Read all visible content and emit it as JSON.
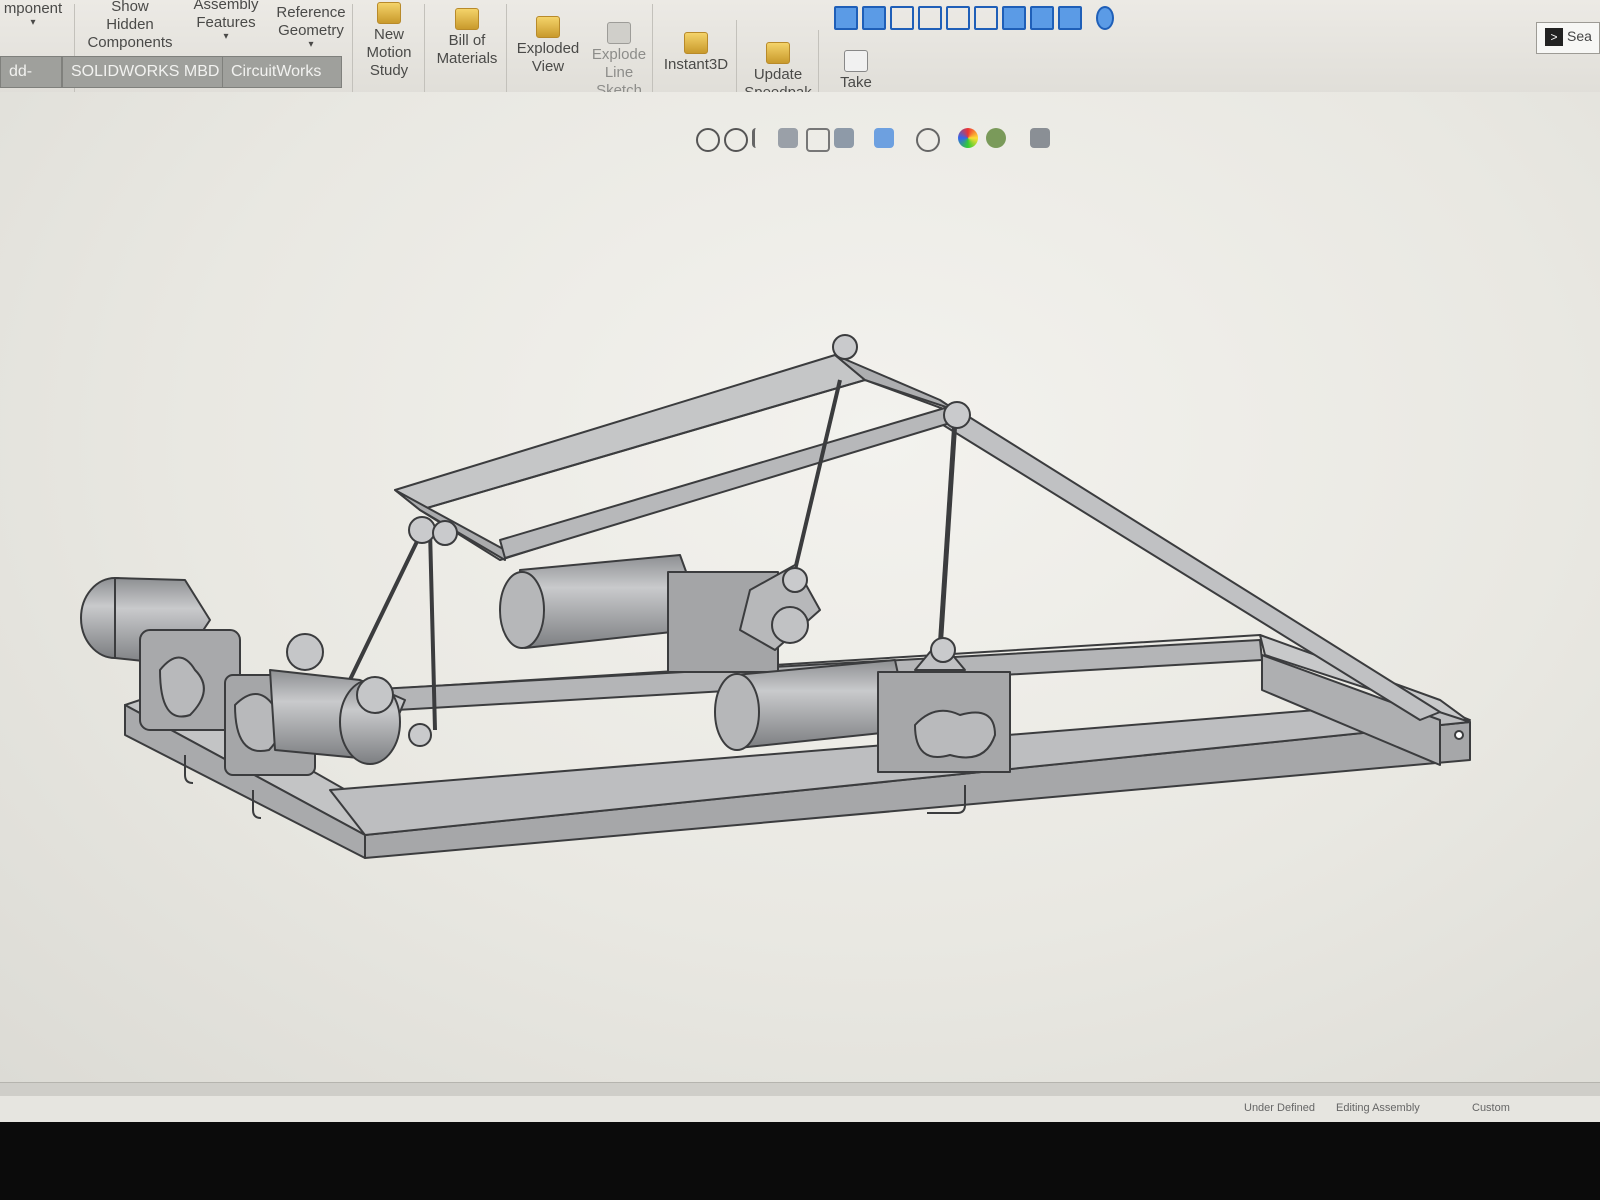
{
  "ribbon": {
    "buttons": [
      {
        "id": "insert-component",
        "label": "mponent"
      },
      {
        "id": "show-hidden",
        "label": "Show\nHidden\nComponents"
      },
      {
        "id": "assembly-features",
        "label": "Assembly\nFeatures"
      },
      {
        "id": "reference-geometry",
        "label": "Reference\nGeometry"
      },
      {
        "id": "new-motion-study",
        "label": "New\nMotion\nStudy"
      },
      {
        "id": "bill-of-materials",
        "label": "Bill of\nMaterials"
      },
      {
        "id": "exploded-view",
        "label": "Exploded\nView"
      },
      {
        "id": "explode-line-sketch",
        "label": "Explode\nLine\nSketch"
      },
      {
        "id": "instant3d",
        "label": "Instant3D"
      },
      {
        "id": "update-speedpak",
        "label": "Update\nSpeedpak"
      },
      {
        "id": "take-snapshot",
        "label": "Take\nSnapshot"
      }
    ],
    "search_label": "Sea"
  },
  "tabs": [
    "dd-Ins",
    "SOLIDWORKS MBD",
    "CircuitWorks"
  ],
  "hud_icons": [
    "zoom-to-fit-icon",
    "zoom-area-icon",
    "previous-view-icon",
    "section-view-icon",
    "dynamic-annotation-icon",
    "view-orientation-icon",
    "display-style-icon",
    "hide-show-icon",
    "edit-appearance-icon",
    "apply-scene-icon",
    "view-settings-icon"
  ],
  "status": {
    "definition": "Under Defined",
    "mode": "Editing Assembly",
    "units": "Custom"
  },
  "colors": {
    "ribbon_bg": "#e5e3de",
    "viewport_bg": "#efeee9",
    "model_fill": "#b9babb",
    "model_stroke": "#3b3c3e",
    "tab_bg": "#9fa09c"
  }
}
